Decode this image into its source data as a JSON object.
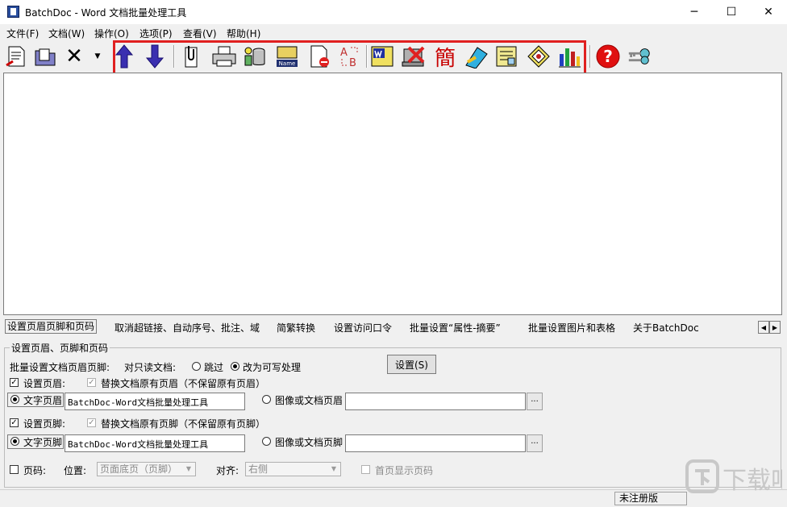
{
  "window": {
    "title": "BatchDoc - Word 文档批量处理工具",
    "min": "─",
    "max": "☐",
    "close": "✕"
  },
  "menu": [
    "文件(F)",
    "文档(W)",
    "操作(O)",
    "选项(P)",
    "查看(V)",
    "帮助(H)"
  ],
  "toolbar": {
    "delete_glyph": "✕",
    "dropdown_glyph": "▼",
    "simplified_glyph": "簡",
    "help_glyph": "?",
    "name_label": "Name",
    "ab_a": "A",
    "ab_b": "B"
  },
  "tabs": [
    "设置页眉页脚和页码",
    "取消超链接、自动序号、批注、域",
    "简繁转换",
    "设置访问口令",
    "批量设置“属性-摘要”",
    "批量设置图片和表格",
    "关于BatchDoc"
  ],
  "tab_arrows": {
    "left": "◀",
    "right": "▶"
  },
  "panel": {
    "group_title": "设置页眉、页脚和页码",
    "batch_label": "批量设置文档页眉页脚:",
    "readonly_label": "对只读文档:",
    "opt_skip": "跳过",
    "opt_writable": "改为可写处理",
    "set_button": "设置(S)",
    "set_header": "设置页眉:",
    "replace_header": "替换文档原有页眉（不保留原有页眉）",
    "text_header": "文字页眉",
    "text_header_value": "BatchDoc-Word文档批量处理工具",
    "image_header": "图像或文档页眉",
    "image_header_value": "",
    "set_footer": "设置页脚:",
    "replace_footer": "替换文档原有页脚（不保留原有页脚）",
    "text_footer": "文字页脚",
    "text_footer_value": "BatchDoc-Word文档批量处理工具",
    "image_footer": "图像或文档页脚",
    "image_footer_value": "",
    "browse": "...",
    "page_num": "页码:",
    "position_label": "位置:",
    "position_value": "页面底页（页脚）",
    "align_label": "对齐:",
    "align_value": "右侧",
    "first_page": "首页显示页码",
    "check_glyph": "✓",
    "select_arrow": "▼"
  },
  "status": {
    "text": "未注册版"
  },
  "watermark": {
    "text": "下载吧"
  },
  "colors": {
    "accent_red": "#e02020",
    "arrow_blue": "#3a2fb0"
  }
}
